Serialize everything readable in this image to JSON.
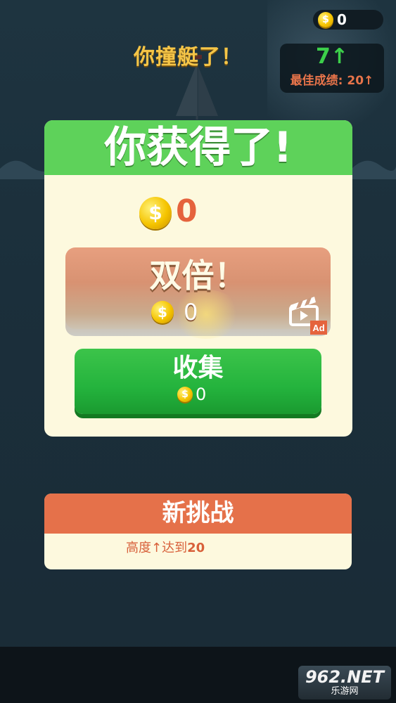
{
  "hud": {
    "coins": "0",
    "crash_title": "你撞艇了！",
    "current_score": "7↑",
    "best_score": "最佳成绩: 20↑"
  },
  "reward_panel": {
    "title": "你获得了!",
    "earned_value": "0",
    "double_button": {
      "label": "双倍！",
      "value": "0",
      "ad_badge": "Ad"
    },
    "collect_button": {
      "label": "收集",
      "value": "0"
    }
  },
  "challenge_panel": {
    "title": "新挑战",
    "desc_prefix": "高度↑达到",
    "desc_value": "20"
  },
  "watermark": {
    "logo": "962.NET",
    "sub": "乐游网"
  },
  "icons": {
    "coin": "coin-icon",
    "ad": "video-ad-icon"
  },
  "colors": {
    "header_green": "#5ed25a",
    "panel_cream": "#fdf9de",
    "coin_gold": "#f5c400",
    "challenge_orange": "#e5714a",
    "score_green": "#3ccf4a"
  }
}
